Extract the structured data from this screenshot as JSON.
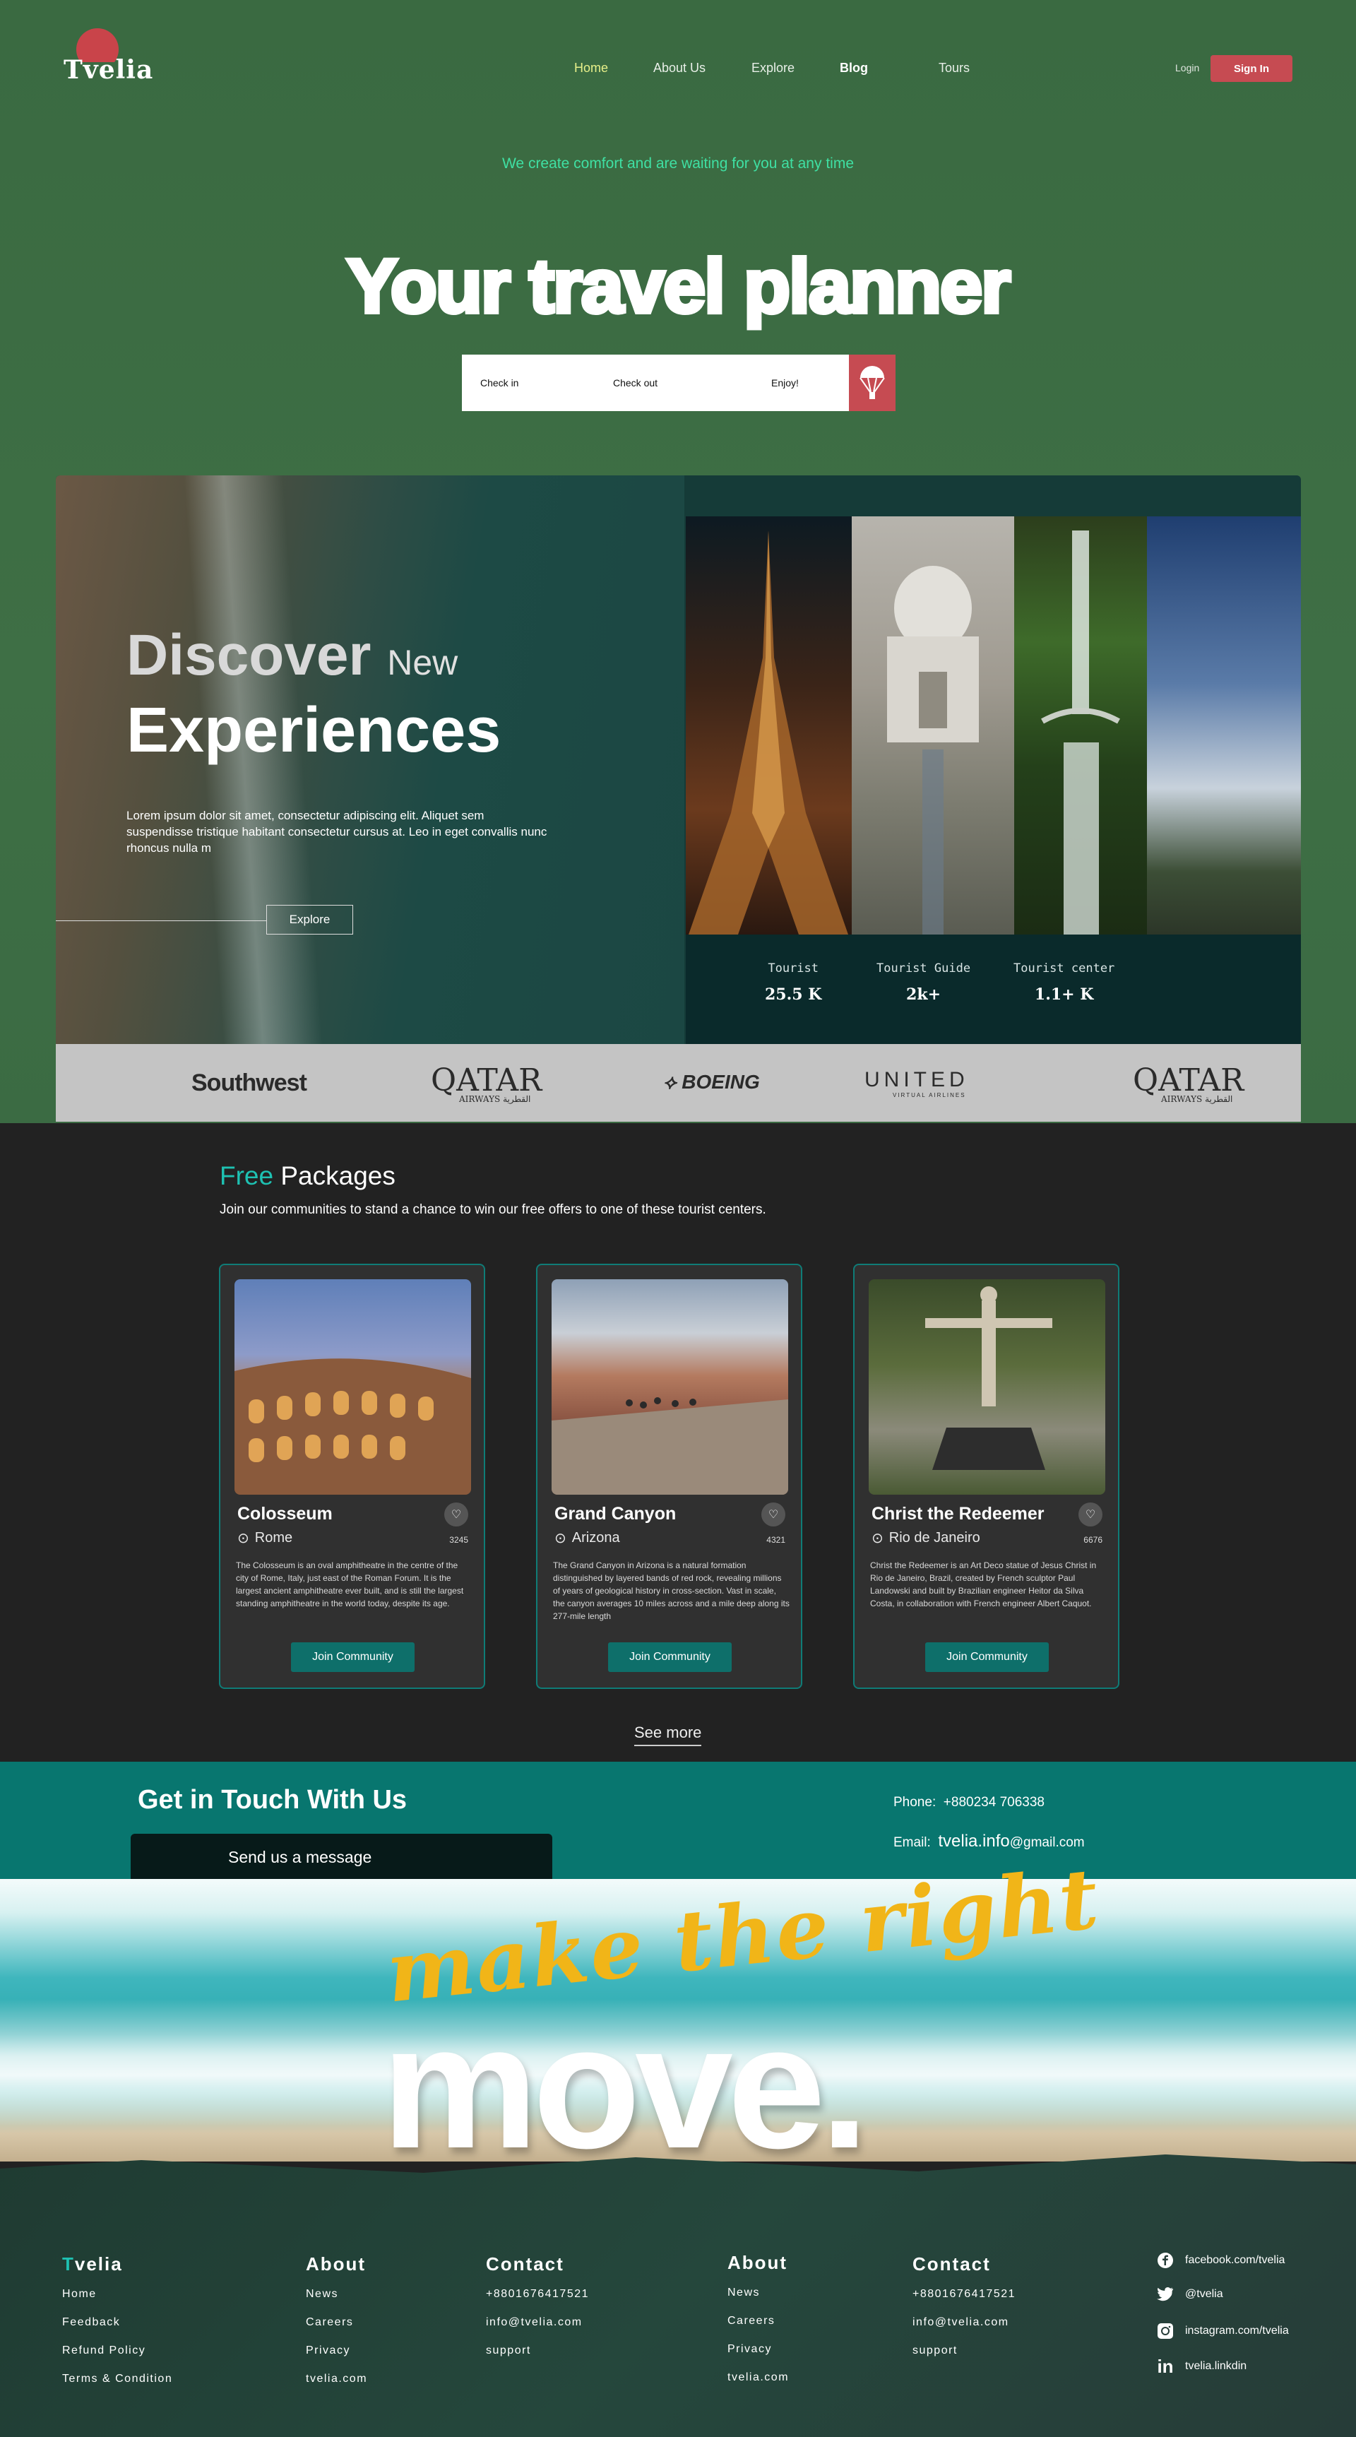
{
  "brand": {
    "name": "Tvelia",
    "accent": "#c64b52",
    "teal": "#08766f",
    "green_bg": "#3b6a42"
  },
  "nav": {
    "home": "Home",
    "about": "About Us",
    "explore": "Explore",
    "blog": "Blog",
    "tours": "Tours",
    "login": "Login",
    "signin": "Sign In"
  },
  "hero": {
    "tagline": "We create comfort and are waiting for you at any time",
    "title": "Your travel planner"
  },
  "search": {
    "checkin": "Check in",
    "checkout": "Check out",
    "enjoy": "Enjoy!",
    "button_icon": "parachute-icon"
  },
  "discover": {
    "title1": "Discover",
    "title_new": "New",
    "title2": "Experiences",
    "text": "Lorem ipsum dolor sit amet, consectetur adipiscing elit. Aliquet sem suspendisse tristique habitant consectetur cursus at. Leo in eget convallis nunc rhoncus nulla m",
    "explore": "Explore",
    "stats": [
      {
        "label": "Tourist",
        "value": "25.5 K"
      },
      {
        "label": "Tourist Guide",
        "value": "2k+"
      },
      {
        "label": "Tourist center",
        "value": "1.1+ K"
      }
    ]
  },
  "partners": [
    "Southwest",
    "QATAR",
    "BOEING",
    "UNITED",
    "QATAR"
  ],
  "partner_subs": {
    "qatar": "AIRWAYS القطرية",
    "united": "VIRTUAL AIRLINES"
  },
  "packages": {
    "title_accent": "Free",
    "title_rest": "Packages",
    "subtitle": "Join our communities to stand a chance to win our free offers to one of these tourist centers.",
    "cards": [
      {
        "name": "Colosseum",
        "location": "Rome",
        "count": "3245",
        "desc": "The Colosseum is an oval amphitheatre in the centre of the city of Rome, Italy, just east of the Roman Forum. It is the largest ancient amphitheatre ever built, and is still the largest standing amphitheatre in the world today, despite its age.",
        "button": "Join Community"
      },
      {
        "name": "Grand Canyon",
        "location": "Arizona",
        "count": "4321",
        "desc": "The Grand Canyon in Arizona is a natural formation distinguished by layered bands of red rock, revealing millions of years of geological history in cross-section. Vast in scale, the canyon averages 10 miles across and a mile deep along its 277-mile length",
        "button": "Join Community"
      },
      {
        "name": "Christ the Redeemer",
        "location": "Rio de Janeiro",
        "count": "6676",
        "desc": "Christ the Redeemer is an Art Deco statue of Jesus Christ in Rio de Janeiro, Brazil, created by French sculptor Paul Landowski and built by Brazilian engineer Heitor da Silva Costa, in collaboration with French engineer Albert Caquot.",
        "button": "Join Community"
      }
    ],
    "see_more": "See more"
  },
  "contact": {
    "title": "Get in Touch With Us",
    "message": "Send us a message",
    "phone_label": "Phone:",
    "phone": "+880234 706338",
    "email_label": "Email:",
    "email_main": "tvelia.info",
    "email_domain": "@gmail.com"
  },
  "banner": {
    "script": "make the right",
    "big": "move."
  },
  "footer": {
    "col1": {
      "title_accent": "T",
      "title_rest": "velia",
      "items": [
        "Home",
        "Feedback",
        "Refund Policy",
        "Terms & Condition"
      ]
    },
    "col2": {
      "title": "About",
      "items": [
        "News",
        "Careers",
        "Privacy",
        "tvelia.com"
      ]
    },
    "col3": {
      "title": "Contact",
      "items": [
        "+8801676417521",
        "info@tvelia.com",
        "support"
      ]
    },
    "col4": {
      "title": "About",
      "items": [
        "News",
        "Careers",
        "Privacy",
        "tvelia.com"
      ]
    },
    "col5": {
      "title": "Contact",
      "items": [
        "+8801676417521",
        "info@tvelia.com",
        "support"
      ]
    },
    "social": [
      {
        "icon": "facebook-icon",
        "label": "facebook.com/tvelia"
      },
      {
        "icon": "twitter-icon",
        "label": "@tvelia"
      },
      {
        "icon": "instagram-icon",
        "label": "instagram.com/tvelia"
      },
      {
        "icon": "linkedin-icon",
        "label": "tvelia.linkdin"
      }
    ]
  }
}
